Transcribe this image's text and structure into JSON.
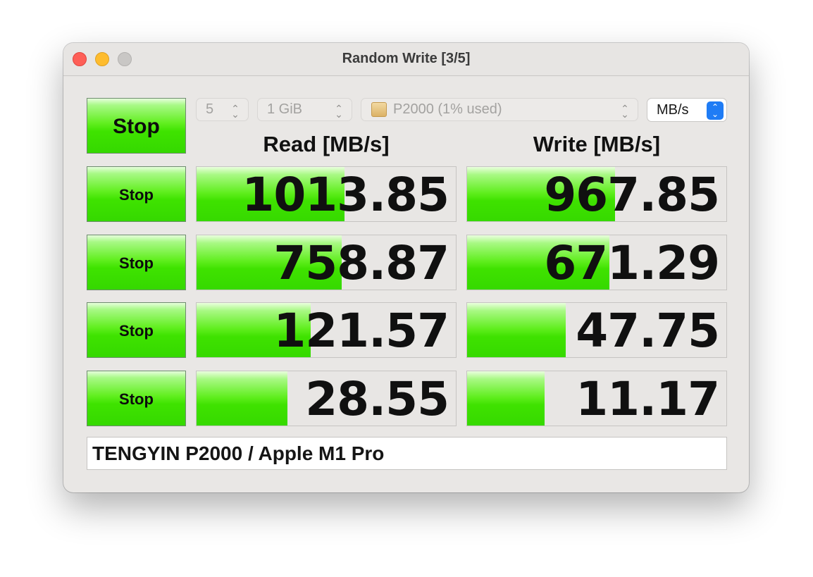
{
  "window": {
    "title": "Random Write [3/5]"
  },
  "controls": {
    "all_button_label": "Stop",
    "count": "5",
    "size": "1 GiB",
    "drive": "P2000 (1% used)",
    "unit": "MB/s"
  },
  "headers": {
    "read": "Read [MB/s]",
    "write": "Write [MB/s]"
  },
  "rows": [
    {
      "button_label": "Stop",
      "read": "1013.85",
      "write": "967.85",
      "read_fill_pct": 57,
      "write_fill_pct": 57
    },
    {
      "button_label": "Stop",
      "read": "758.87",
      "write": "671.29",
      "read_fill_pct": 56,
      "write_fill_pct": 55
    },
    {
      "button_label": "Stop",
      "read": "121.57",
      "write": "47.75",
      "read_fill_pct": 44,
      "write_fill_pct": 38
    },
    {
      "button_label": "Stop",
      "read": "28.55",
      "write": "11.17",
      "read_fill_pct": 35,
      "write_fill_pct": 30
    }
  ],
  "comment": "TENGYIN P2000 / Apple M1 Pro",
  "colors": {
    "bar_green": "#3fe300",
    "unit_stepper": "#1f7cf5",
    "close": "#fe5f57",
    "minimize": "#febc2e"
  }
}
